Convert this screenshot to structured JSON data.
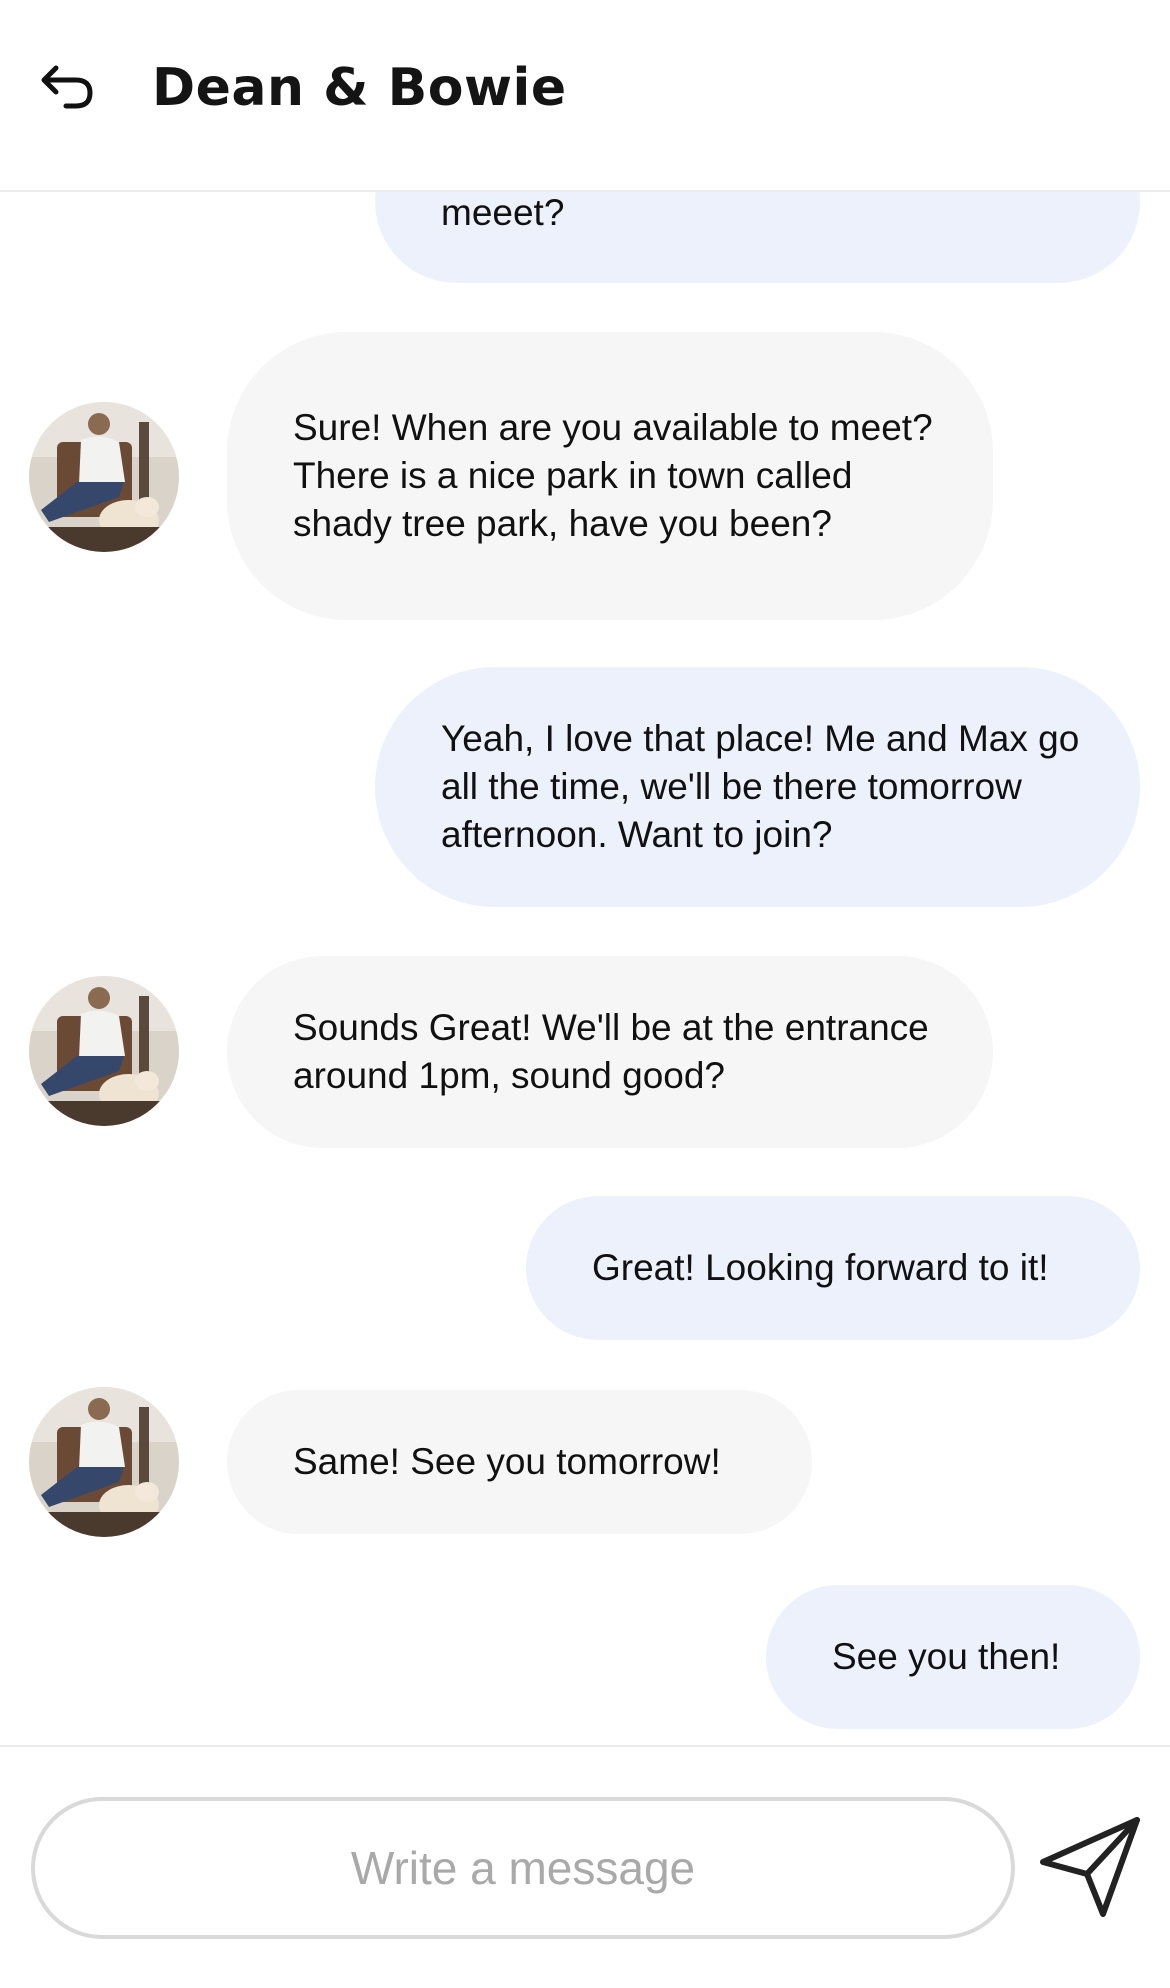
{
  "header": {
    "title": "Dean & Bowie",
    "back_icon": "back-arrow-icon"
  },
  "messages": [
    {
      "direction": "outgoing",
      "text": "meeet?"
    },
    {
      "direction": "incoming",
      "text": "Sure! When are you available to meet? There is a nice park in town called shady tree park, have you been?"
    },
    {
      "direction": "outgoing",
      "text": "Yeah, I love that place! Me and Max go all the time, we'll be there tomorrow afternoon. Want to join?"
    },
    {
      "direction": "incoming",
      "text": "Sounds Great! We'll be at the entrance around 1pm, sound good?"
    },
    {
      "direction": "outgoing",
      "text": "Great! Looking forward to it!"
    },
    {
      "direction": "incoming",
      "text": "Same! See you tomorrow!"
    },
    {
      "direction": "outgoing",
      "text": "See you then!"
    }
  ],
  "composer": {
    "placeholder": "Write a message",
    "value": "",
    "send_icon": "send-icon"
  },
  "colors": {
    "outgoing_bubble": "#edf1fc",
    "incoming_bubble": "#f6f6f6",
    "text": "#111111",
    "placeholder": "#a9a9a9"
  }
}
